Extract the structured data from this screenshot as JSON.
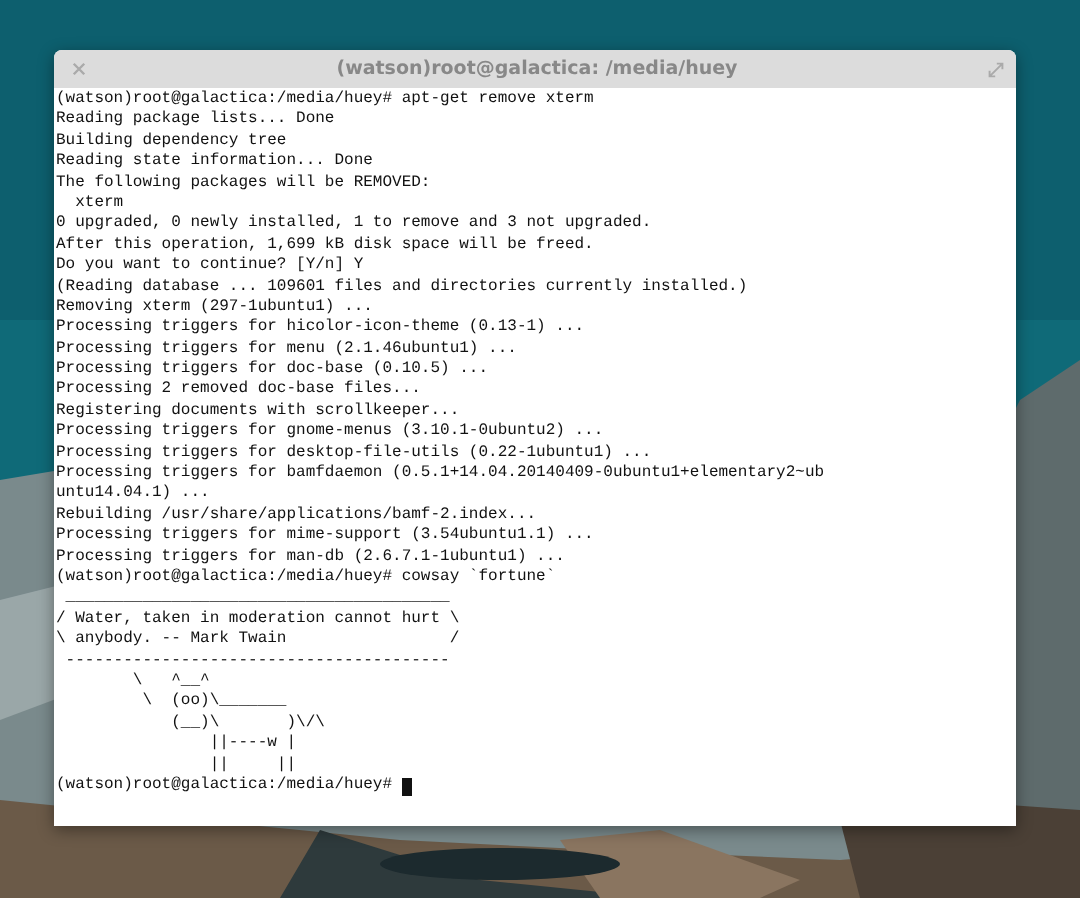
{
  "window": {
    "title": "(watson)root@galactica: /media/huey"
  },
  "terminal": {
    "lines": [
      "(watson)root@galactica:/media/huey# apt-get remove xterm",
      "Reading package lists... Done",
      "Building dependency tree",
      "Reading state information... Done",
      "The following packages will be REMOVED:",
      "  xterm",
      "0 upgraded, 0 newly installed, 1 to remove and 3 not upgraded.",
      "After this operation, 1,699 kB disk space will be freed.",
      "Do you want to continue? [Y/n] Y",
      "(Reading database ... 109601 files and directories currently installed.)",
      "Removing xterm (297-1ubuntu1) ...",
      "Processing triggers for hicolor-icon-theme (0.13-1) ...",
      "Processing triggers for menu (2.1.46ubuntu1) ...",
      "Processing triggers for doc-base (0.10.5) ...",
      "Processing 2 removed doc-base files...",
      "Registering documents with scrollkeeper...",
      "Processing triggers for gnome-menus (3.10.1-0ubuntu2) ...",
      "Processing triggers for desktop-file-utils (0.22-1ubuntu1) ...",
      "Processing triggers for bamfdaemon (0.5.1+14.04.20140409-0ubuntu1+elementary2~ub",
      "untu14.04.1) ...",
      "Rebuilding /usr/share/applications/bamf-2.index...",
      "Processing triggers for mime-support (3.54ubuntu1.1) ...",
      "Processing triggers for man-db (2.6.7.1-1ubuntu1) ...",
      "(watson)root@galactica:/media/huey# cowsay `fortune`",
      " ________________________________________",
      "/ Water, taken in moderation cannot hurt \\",
      "\\ anybody. -- Mark Twain                 /",
      " ----------------------------------------",
      "        \\   ^__^",
      "         \\  (oo)\\_______",
      "            (__)\\       )\\/\\",
      "                ||----w |",
      "                ||     ||"
    ],
    "prompt": "(watson)root@galactica:/media/huey#"
  }
}
